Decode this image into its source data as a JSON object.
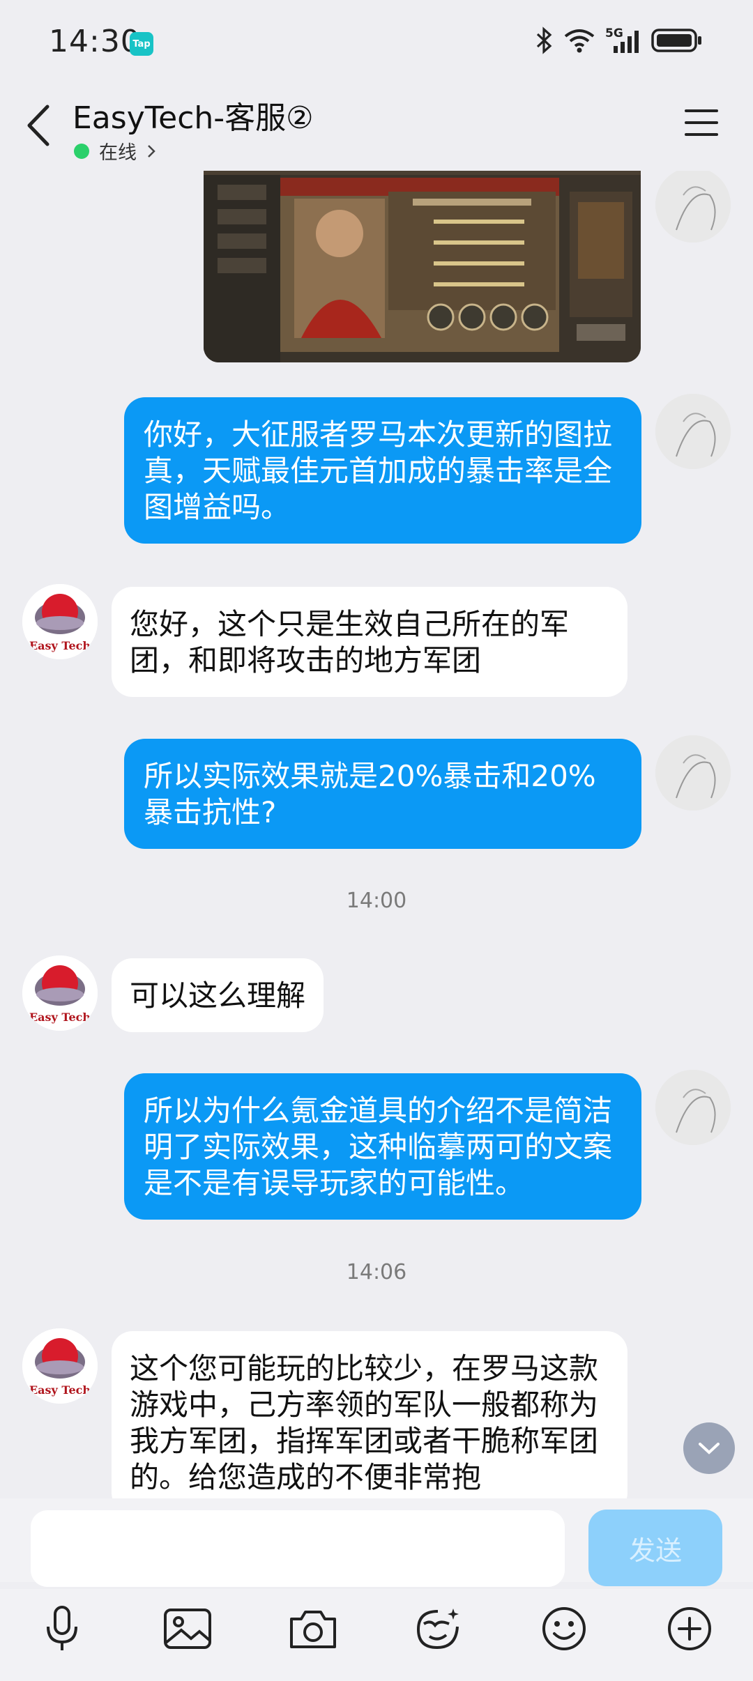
{
  "status_bar": {
    "time": "14:30",
    "tap_badge": "Tap",
    "network": "5G"
  },
  "header": {
    "title": "EasyTech-客服②",
    "presence": "在线"
  },
  "messages": {
    "m1": "你好，大征服者罗马本次更新的图拉真，天赋最佳元首加成的暴击率是全图增益吗。",
    "m2": "您好，这个只是生效自己所在的军团，和即将攻击的地方军团",
    "m3": "所以实际效果就是20%暴击和20%暴击抗性?",
    "ts1": "14:00",
    "m4": "可以这么理解",
    "m5": "所以为什么氪金道具的介绍不是简洁明了实际效果，这种临摹两可的文案是不是有误导玩家的可能性。",
    "ts2": "14:06",
    "m6": "这个您可能玩的比较少，在罗马这款游戏中，己方率领的军队一般都称为我方军团，指挥军团或者干脆称军团的。给您造成的不便非常抱"
  },
  "easytech_avatar_text": "Easy Tech",
  "input": {
    "placeholder": "",
    "send_label": "发送"
  },
  "colors": {
    "outgoing_bubble": "#0b99f5",
    "incoming_bubble": "#ffffff",
    "background": "#eeeef2",
    "send_button": "#8dd0fb",
    "presence": "#2bd06b"
  },
  "icons": [
    "microphone-icon",
    "image-icon",
    "camera-icon",
    "sticker-icon",
    "emoji-icon",
    "plus-icon"
  ]
}
